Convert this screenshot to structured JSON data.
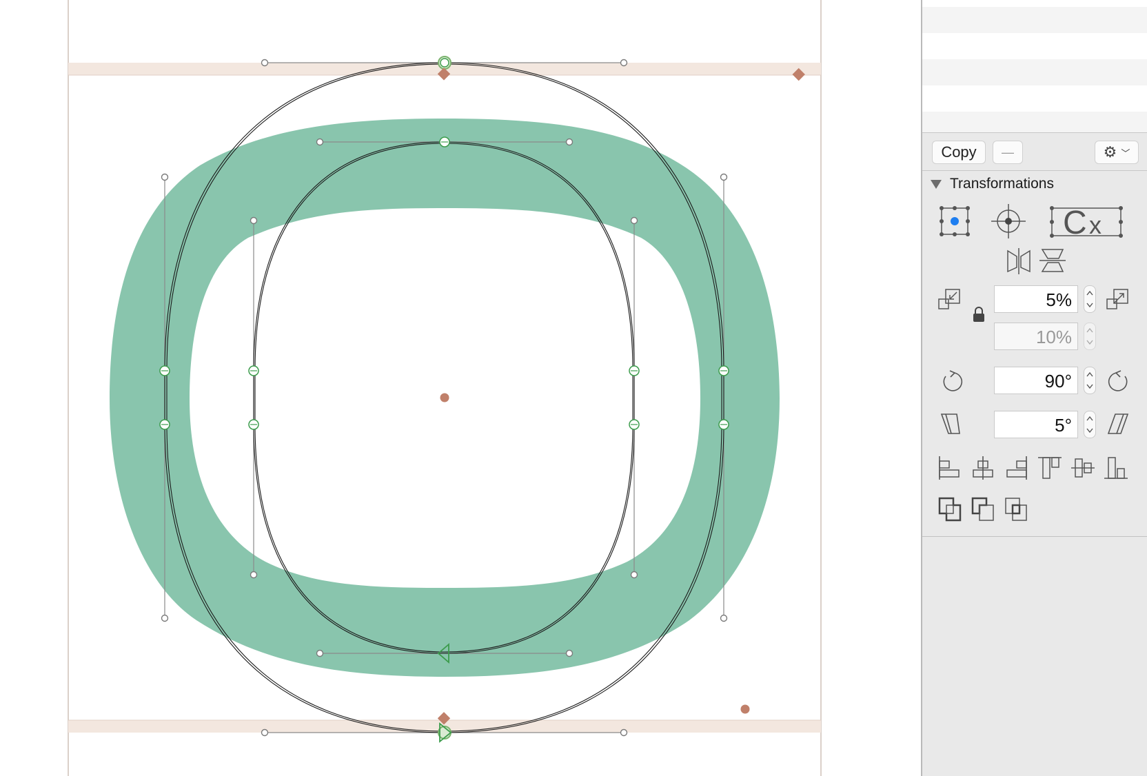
{
  "panel": {
    "copy_label": "Copy",
    "minus_label": "—",
    "settings_icon": "gear-icon",
    "section_title": "Transformations",
    "scale_x": "5%",
    "scale_y": "10%",
    "rotate": "90°",
    "slant": "5°"
  },
  "colors": {
    "glyph_fill": "#89c5ad",
    "guide_band": "#f3e7df",
    "anchor_marker": "#c0806a",
    "node_green": "#3c9c4c"
  }
}
